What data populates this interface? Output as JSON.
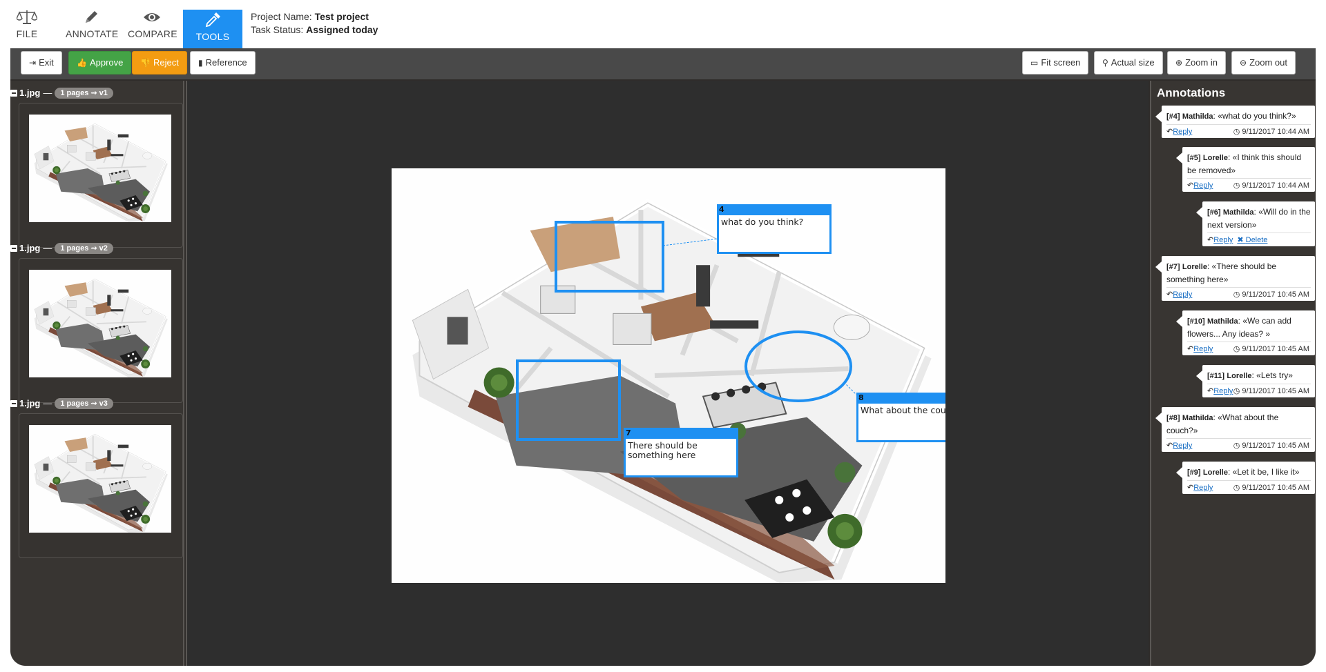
{
  "header": {
    "menu": [
      {
        "label": "FILE",
        "icon": "balance-scale-icon"
      },
      {
        "label": "ANNOTATE",
        "icon": "pencil-icon"
      },
      {
        "label": "COMPARE",
        "icon": "eye-icon"
      },
      {
        "label": "TOOLS",
        "icon": "eyedropper-icon",
        "active": true
      }
    ],
    "project_name_label": "Project Name:",
    "project_name": "Test project",
    "task_status_label": "Task Status:",
    "task_status": "Assigned today",
    "active_color": "#1e90f2"
  },
  "toolbar": {
    "exit": "Exit",
    "approve": "Approve",
    "reject": "Reject",
    "reference": "Reference",
    "fit_screen": "Fit screen",
    "actual_size": "Actual size",
    "zoom_in": "Zoom in",
    "zoom_out": "Zoom out",
    "approve_color": "#44a346",
    "reject_color": "#f39c12"
  },
  "versions": [
    {
      "file": "1.jpg",
      "sep": "—",
      "pill": "1 pages ⇝ v1"
    },
    {
      "file": "1.jpg",
      "sep": "—",
      "pill": "1 pages ⇝ v2"
    },
    {
      "file": "1.jpg",
      "sep": "—",
      "pill": "1 pages ⇝ v3"
    }
  ],
  "canvas": {
    "notes": [
      {
        "num": "4",
        "text": "what do you think?"
      },
      {
        "num": "7",
        "text": "There should be something here"
      },
      {
        "num": "8",
        "text": "What about the couch?"
      }
    ]
  },
  "annotations": {
    "title": "Annotations",
    "items": [
      {
        "id": "[#4]",
        "author": "Mathilda",
        "text": "«what do you think?»",
        "reply": "Reply",
        "time": "9/11/2017 10:44 AM"
      },
      {
        "id": "[#5]",
        "author": "Lorelle",
        "text": "«I think this should be removed»",
        "reply": "Reply",
        "time": "9/11/2017 10:44 AM"
      },
      {
        "id": "[#6]",
        "author": "Mathilda",
        "text": "«Will do in the next version»",
        "reply": "Reply",
        "delete": "Delete",
        "time": ""
      },
      {
        "id": "[#7]",
        "author": "Lorelle",
        "text": "«There should be something here»",
        "reply": "Reply",
        "time": "9/11/2017 10:45 AM"
      },
      {
        "id": "[#10]",
        "author": "Mathilda",
        "text": "«We can add flowers... Any ideas? »",
        "reply": "Reply",
        "time": "9/11/2017 10:45 AM"
      },
      {
        "id": "[#11]",
        "author": "Lorelle",
        "text": "«Lets try»",
        "reply": "Reply",
        "time": "9/11/2017 10:45 AM"
      },
      {
        "id": "[#8]",
        "author": "Mathilda",
        "text": "«What about the couch?»",
        "reply": "Reply",
        "time": "9/11/2017 10:45 AM"
      },
      {
        "id": "[#9]",
        "author": "Lorelle",
        "text": "«Let it be, I like it»",
        "reply": "Reply",
        "time": "9/11/2017 10:45 AM"
      }
    ]
  }
}
